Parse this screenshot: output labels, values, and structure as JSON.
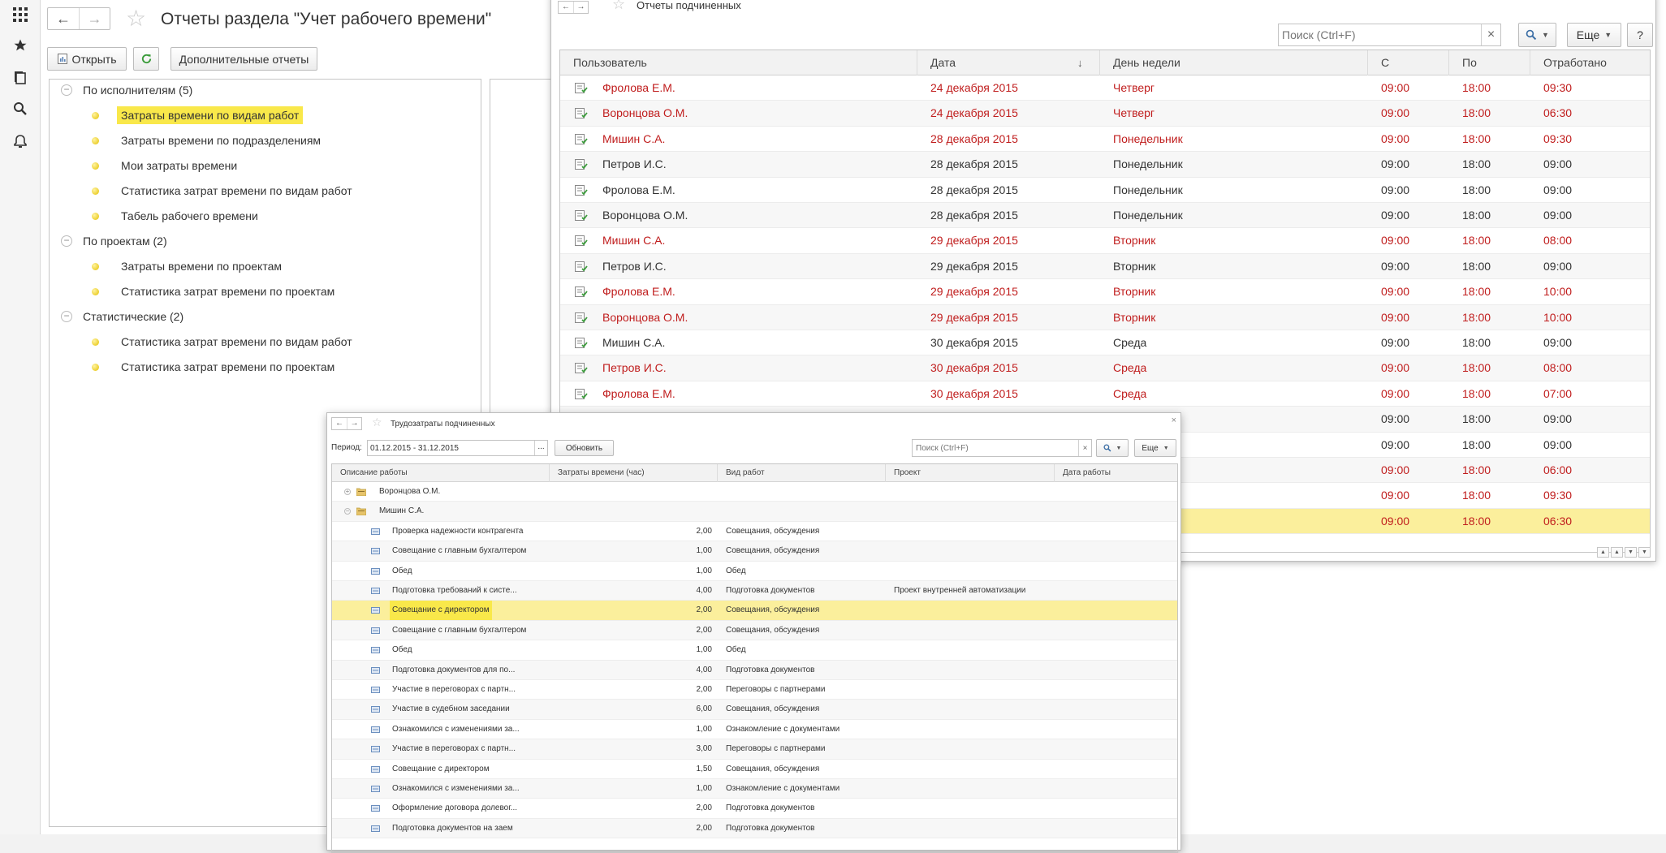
{
  "main": {
    "title": "Отчеты раздела \"Учет рабочего времени\"",
    "open_label": "Открыть",
    "additional_reports_label": "Дополнительные отчеты",
    "tree": [
      {
        "type": "group",
        "label": "По исполнителям (5)"
      },
      {
        "type": "item",
        "label": "Затраты времени по видам работ",
        "selected": true
      },
      {
        "type": "item",
        "label": "Затраты времени по подразделениям"
      },
      {
        "type": "item",
        "label": "Мои затраты времени"
      },
      {
        "type": "item",
        "label": "Статистика затрат времени по видам работ"
      },
      {
        "type": "item",
        "label": "Табель рабочего времени"
      },
      {
        "type": "group",
        "label": "По проектам (2)"
      },
      {
        "type": "item",
        "label": "Затраты времени по проектам"
      },
      {
        "type": "item",
        "label": "Статистика затрат времени по проектам"
      },
      {
        "type": "group",
        "label": "Статистические (2)"
      },
      {
        "type": "item",
        "label": "Статистика затрат времени по видам работ"
      },
      {
        "type": "item",
        "label": "Статистика затрат времени по проектам"
      }
    ]
  },
  "reports": {
    "title": "Отчеты подчиненных",
    "search_placeholder": "Поиск (Ctrl+F)",
    "more_label": "Еще",
    "help_label": "?",
    "columns": [
      "Пользователь",
      "Дата",
      "День недели",
      "С",
      "По",
      "Отработано"
    ],
    "rows": [
      {
        "user": "Фролова Е.М.",
        "date": "24 декабря 2015",
        "day": "Четверг",
        "from": "09:00",
        "to": "18:00",
        "worked": "09:30",
        "red": true
      },
      {
        "user": "Воронцова О.М.",
        "date": "24 декабря 2015",
        "day": "Четверг",
        "from": "09:00",
        "to": "18:00",
        "worked": "06:30",
        "red": true
      },
      {
        "user": "Мишин С.А.",
        "date": "28 декабря 2015",
        "day": "Понедельник",
        "from": "09:00",
        "to": "18:00",
        "worked": "09:30",
        "red": true
      },
      {
        "user": "Петров И.С.",
        "date": "28 декабря 2015",
        "day": "Понедельник",
        "from": "09:00",
        "to": "18:00",
        "worked": "09:00",
        "red": false
      },
      {
        "user": "Фролова Е.М.",
        "date": "28 декабря 2015",
        "day": "Понедельник",
        "from": "09:00",
        "to": "18:00",
        "worked": "09:00",
        "red": false
      },
      {
        "user": "Воронцова О.М.",
        "date": "28 декабря 2015",
        "day": "Понедельник",
        "from": "09:00",
        "to": "18:00",
        "worked": "09:00",
        "red": false
      },
      {
        "user": "Мишин С.А.",
        "date": "29 декабря 2015",
        "day": "Вторник",
        "from": "09:00",
        "to": "18:00",
        "worked": "08:00",
        "red": true
      },
      {
        "user": "Петров И.С.",
        "date": "29 декабря 2015",
        "day": "Вторник",
        "from": "09:00",
        "to": "18:00",
        "worked": "09:00",
        "red": false
      },
      {
        "user": "Фролова Е.М.",
        "date": "29 декабря 2015",
        "day": "Вторник",
        "from": "09:00",
        "to": "18:00",
        "worked": "10:00",
        "red": true
      },
      {
        "user": "Воронцова О.М.",
        "date": "29 декабря 2015",
        "day": "Вторник",
        "from": "09:00",
        "to": "18:00",
        "worked": "10:00",
        "red": true
      },
      {
        "user": "Мишин С.А.",
        "date": "30 декабря 2015",
        "day": "Среда",
        "from": "09:00",
        "to": "18:00",
        "worked": "09:00",
        "red": false
      },
      {
        "user": "Петров И.С.",
        "date": "30 декабря 2015",
        "day": "Среда",
        "from": "09:00",
        "to": "18:00",
        "worked": "08:00",
        "red": true
      },
      {
        "user": "Фролова Е.М.",
        "date": "30 декабря 2015",
        "day": "Среда",
        "from": "09:00",
        "to": "18:00",
        "worked": "07:00",
        "red": true
      },
      {
        "user": "",
        "date": "",
        "day": "",
        "from": "09:00",
        "to": "18:00",
        "worked": "09:00",
        "red": false
      },
      {
        "user": "",
        "date": "",
        "day": "",
        "from": "09:00",
        "to": "18:00",
        "worked": "09:00",
        "red": false
      },
      {
        "user": "",
        "date": "",
        "day": "",
        "from": "09:00",
        "to": "18:00",
        "worked": "06:00",
        "red": true
      },
      {
        "user": "",
        "date": "",
        "day": "",
        "from": "09:00",
        "to": "18:00",
        "worked": "09:30",
        "red": true
      },
      {
        "user": "",
        "date": "",
        "day": "",
        "from": "09:00",
        "to": "18:00",
        "worked": "06:30",
        "red": true,
        "highlight": true
      }
    ]
  },
  "labor": {
    "title": "Трудозатраты подчиненных",
    "period_label": "Период:",
    "period_value": "01.12.2015 - 31.12.2015",
    "period_dots": "...",
    "refresh_label": "Обновить",
    "search_placeholder": "Поиск (Ctrl+F)",
    "more_label": "Еще",
    "columns": [
      "Описание работы",
      "Затраты времени (час)",
      "Вид работ",
      "Проект",
      "Дата работы"
    ],
    "groups": [
      {
        "label": "Воронцова О.М.",
        "expanded": false
      },
      {
        "label": "Мишин С.А.",
        "expanded": true
      }
    ],
    "rows": [
      {
        "desc": "Проверка надежности контрагента",
        "hours": "2,00",
        "kind": "Совещания, обсуждения",
        "project": ""
      },
      {
        "desc": "Совещание с главным бухгалтером",
        "hours": "1,00",
        "kind": "Совещания, обсуждения",
        "project": ""
      },
      {
        "desc": "Обед",
        "hours": "1,00",
        "kind": "Обед",
        "project": ""
      },
      {
        "desc": "Подготовка требований к систе...",
        "hours": "4,00",
        "kind": "Подготовка документов",
        "project": "Проект внутренней автоматизации"
      },
      {
        "desc": "Совещание с директором",
        "hours": "2,00",
        "kind": "Совещания, обсуждения",
        "project": "",
        "highlight": true
      },
      {
        "desc": "Совещание с главным бухгалтером",
        "hours": "2,00",
        "kind": "Совещания, обсуждения",
        "project": ""
      },
      {
        "desc": "Обед",
        "hours": "1,00",
        "kind": "Обед",
        "project": ""
      },
      {
        "desc": "Подготовка документов для по...",
        "hours": "4,00",
        "kind": "Подготовка документов",
        "project": ""
      },
      {
        "desc": "Участие в переговорах с партн...",
        "hours": "2,00",
        "kind": "Переговоры с партнерами",
        "project": ""
      },
      {
        "desc": "Участие в судебном заседании",
        "hours": "6,00",
        "kind": "Совещания, обсуждения",
        "project": ""
      },
      {
        "desc": "Ознакомился с изменениями за...",
        "hours": "1,00",
        "kind": "Ознакомление с документами",
        "project": ""
      },
      {
        "desc": "Участие в переговорах с партн...",
        "hours": "3,00",
        "kind": "Переговоры с партнерами",
        "project": ""
      },
      {
        "desc": "Совещание с директором",
        "hours": "1,50",
        "kind": "Совещания, обсуждения",
        "project": ""
      },
      {
        "desc": "Ознакомился с изменениями за...",
        "hours": "1,00",
        "kind": "Ознакомление с документами",
        "project": ""
      },
      {
        "desc": "Оформление договора долевог...",
        "hours": "2,00",
        "kind": "Подготовка документов",
        "project": ""
      },
      {
        "desc": "Подготовка документов на заем",
        "hours": "2,00",
        "kind": "Подготовка документов",
        "project": ""
      }
    ]
  },
  "colors": {
    "red_text": "#c01d1d",
    "highlight": "#f9e84a",
    "row_highlight": "#fbef9c",
    "accent_blue": "#3b6ea5"
  }
}
